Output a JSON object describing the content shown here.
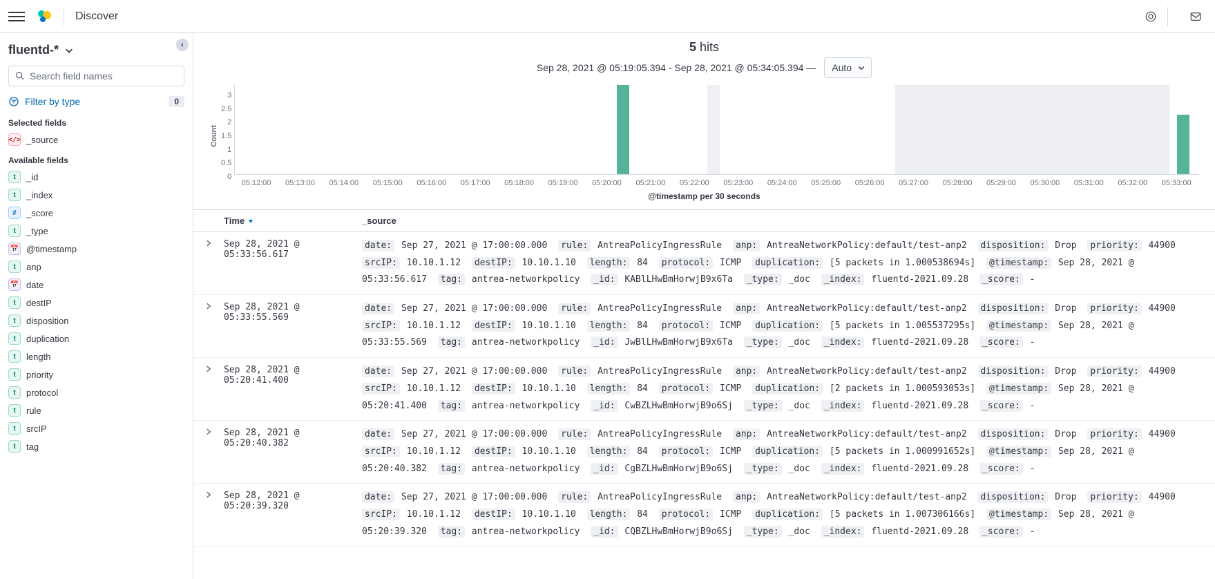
{
  "header": {
    "app_title": "Discover"
  },
  "sidebar": {
    "index_pattern": "fluentd-*",
    "search_placeholder": "Search field names",
    "filter_by_type_label": "Filter by type",
    "filter_count": "0",
    "selected_label": "Selected fields",
    "available_label": "Available fields",
    "selected_fields": [
      {
        "name": "_source",
        "tok": "src",
        "glyph": "</>"
      }
    ],
    "available_fields": [
      {
        "name": "_id",
        "tok": "t",
        "glyph": "t"
      },
      {
        "name": "_index",
        "tok": "t",
        "glyph": "t"
      },
      {
        "name": "_score",
        "tok": "n",
        "glyph": "#"
      },
      {
        "name": "_type",
        "tok": "t",
        "glyph": "t"
      },
      {
        "name": "@timestamp",
        "tok": "d",
        "glyph": "📅"
      },
      {
        "name": "anp",
        "tok": "t",
        "glyph": "t"
      },
      {
        "name": "date",
        "tok": "d",
        "glyph": "📅"
      },
      {
        "name": "destIP",
        "tok": "t",
        "glyph": "t"
      },
      {
        "name": "disposition",
        "tok": "t",
        "glyph": "t"
      },
      {
        "name": "duplication",
        "tok": "t",
        "glyph": "t"
      },
      {
        "name": "length",
        "tok": "t",
        "glyph": "t"
      },
      {
        "name": "priority",
        "tok": "t",
        "glyph": "t"
      },
      {
        "name": "protocol",
        "tok": "t",
        "glyph": "t"
      },
      {
        "name": "rule",
        "tok": "t",
        "glyph": "t"
      },
      {
        "name": "srcIP",
        "tok": "t",
        "glyph": "t"
      },
      {
        "name": "tag",
        "tok": "t",
        "glyph": "t"
      }
    ]
  },
  "hits": {
    "count": "5",
    "label": "hits"
  },
  "time_range": "Sep 28, 2021 @ 05:19:05.394 - Sep 28, 2021 @ 05:34:05.394 —",
  "interval": "Auto",
  "chart_data": {
    "type": "bar",
    "ylabel": "Count",
    "xlabel": "@timestamp per 30 seconds",
    "y_ticks": [
      "3",
      "2.5",
      "2",
      "1.5",
      "1",
      "0.5",
      "0"
    ],
    "x_ticks": [
      "05:12:00",
      "05:13:00",
      "05:14:00",
      "05:15:00",
      "05:16:00",
      "05:17:00",
      "05:18:00",
      "05:19:00",
      "05:20:00",
      "05:21:00",
      "05:22:00",
      "05:23:00",
      "05:24:00",
      "05:25:00",
      "05:26:00",
      "05:27:00",
      "05:28:00",
      "05:29:00",
      "05:30:00",
      "05:31:00",
      "05:32:00",
      "05:33:00"
    ],
    "series": [
      {
        "name": "hits",
        "bars": [
          {
            "x_pct": 39.6,
            "value": 3
          },
          {
            "x_pct": 97.8,
            "value": 2
          }
        ]
      }
    ],
    "ghost_bars": [
      {
        "x_pct": 49.0
      }
    ],
    "brush": {
      "start_pct": 68.5,
      "end_pct": 97.0
    },
    "ylim": [
      0,
      3
    ]
  },
  "table": {
    "col_time": "Time",
    "col_source": "_source",
    "rows": [
      {
        "time": "Sep 28, 2021 @ 05:33:56.617",
        "fields": [
          [
            "date:",
            "Sep 27, 2021 @ 17:00:00.000"
          ],
          [
            "rule:",
            "AntreaPolicyIngressRule"
          ],
          [
            "anp:",
            "AntreaNetworkPolicy:default/test-anp2"
          ],
          [
            "disposition:",
            "Drop"
          ],
          [
            "priority:",
            "44900"
          ],
          [
            "srcIP:",
            "10.10.1.12"
          ],
          [
            "destIP:",
            "10.10.1.10"
          ],
          [
            "length:",
            "84"
          ],
          [
            "protocol:",
            "ICMP"
          ],
          [
            "duplication:",
            "[5 packets in 1.000538694s]"
          ],
          [
            "@timestamp:",
            "Sep 28, 2021 @ 05:33:56.617"
          ],
          [
            "tag:",
            "antrea-networkpolicy"
          ],
          [
            "_id:",
            "KABlLHwBmHorwjB9x6Ta"
          ],
          [
            "_type:",
            "_doc"
          ],
          [
            "_index:",
            "fluentd-2021.09.28"
          ],
          [
            "_score:",
            " -"
          ]
        ]
      },
      {
        "time": "Sep 28, 2021 @ 05:33:55.569",
        "fields": [
          [
            "date:",
            "Sep 27, 2021 @ 17:00:00.000"
          ],
          [
            "rule:",
            "AntreaPolicyIngressRule"
          ],
          [
            "anp:",
            "AntreaNetworkPolicy:default/test-anp2"
          ],
          [
            "disposition:",
            "Drop"
          ],
          [
            "priority:",
            "44900"
          ],
          [
            "srcIP:",
            "10.10.1.12"
          ],
          [
            "destIP:",
            "10.10.1.10"
          ],
          [
            "length:",
            "84"
          ],
          [
            "protocol:",
            "ICMP"
          ],
          [
            "duplication:",
            "[5 packets in 1.005537295s]"
          ],
          [
            "@timestamp:",
            "Sep 28, 2021 @ 05:33:55.569"
          ],
          [
            "tag:",
            "antrea-networkpolicy"
          ],
          [
            "_id:",
            "JwBlLHwBmHorwjB9x6Ta"
          ],
          [
            "_type:",
            "_doc"
          ],
          [
            "_index:",
            "fluentd-2021.09.28"
          ],
          [
            "_score:",
            " -"
          ]
        ]
      },
      {
        "time": "Sep 28, 2021 @ 05:20:41.400",
        "fields": [
          [
            "date:",
            "Sep 27, 2021 @ 17:00:00.000"
          ],
          [
            "rule:",
            "AntreaPolicyIngressRule"
          ],
          [
            "anp:",
            "AntreaNetworkPolicy:default/test-anp2"
          ],
          [
            "disposition:",
            "Drop"
          ],
          [
            "priority:",
            "44900"
          ],
          [
            "srcIP:",
            "10.10.1.12"
          ],
          [
            "destIP:",
            "10.10.1.10"
          ],
          [
            "length:",
            "84"
          ],
          [
            "protocol:",
            "ICMP"
          ],
          [
            "duplication:",
            "[2 packets in 1.000593053s]"
          ],
          [
            "@timestamp:",
            "Sep 28, 2021 @ 05:20:41.400"
          ],
          [
            "tag:",
            "antrea-networkpolicy"
          ],
          [
            "_id:",
            "CwBZLHwBmHorwjB9o6Sj"
          ],
          [
            "_type:",
            "_doc"
          ],
          [
            "_index:",
            "fluentd-2021.09.28"
          ],
          [
            "_score:",
            " -"
          ]
        ]
      },
      {
        "time": "Sep 28, 2021 @ 05:20:40.382",
        "fields": [
          [
            "date:",
            "Sep 27, 2021 @ 17:00:00.000"
          ],
          [
            "rule:",
            "AntreaPolicyIngressRule"
          ],
          [
            "anp:",
            "AntreaNetworkPolicy:default/test-anp2"
          ],
          [
            "disposition:",
            "Drop"
          ],
          [
            "priority:",
            "44900"
          ],
          [
            "srcIP:",
            "10.10.1.12"
          ],
          [
            "destIP:",
            "10.10.1.10"
          ],
          [
            "length:",
            "84"
          ],
          [
            "protocol:",
            "ICMP"
          ],
          [
            "duplication:",
            "[5 packets in 1.000991652s]"
          ],
          [
            "@timestamp:",
            "Sep 28, 2021 @ 05:20:40.382"
          ],
          [
            "tag:",
            "antrea-networkpolicy"
          ],
          [
            "_id:",
            "CgBZLHwBmHorwjB9o6Sj"
          ],
          [
            "_type:",
            "_doc"
          ],
          [
            "_index:",
            "fluentd-2021.09.28"
          ],
          [
            "_score:",
            " -"
          ]
        ]
      },
      {
        "time": "Sep 28, 2021 @ 05:20:39.320",
        "fields": [
          [
            "date:",
            "Sep 27, 2021 @ 17:00:00.000"
          ],
          [
            "rule:",
            "AntreaPolicyIngressRule"
          ],
          [
            "anp:",
            "AntreaNetworkPolicy:default/test-anp2"
          ],
          [
            "disposition:",
            "Drop"
          ],
          [
            "priority:",
            "44900"
          ],
          [
            "srcIP:",
            "10.10.1.12"
          ],
          [
            "destIP:",
            "10.10.1.10"
          ],
          [
            "length:",
            "84"
          ],
          [
            "protocol:",
            "ICMP"
          ],
          [
            "duplication:",
            "[5 packets in 1.007306166s]"
          ],
          [
            "@timestamp:",
            "Sep 28, 2021 @ 05:20:39.320"
          ],
          [
            "tag:",
            "antrea-networkpolicy"
          ],
          [
            "_id:",
            "CQBZLHwBmHorwjB9o6Sj"
          ],
          [
            "_type:",
            "_doc"
          ],
          [
            "_index:",
            "fluentd-2021.09.28"
          ],
          [
            "_score:",
            " -"
          ]
        ]
      }
    ]
  }
}
